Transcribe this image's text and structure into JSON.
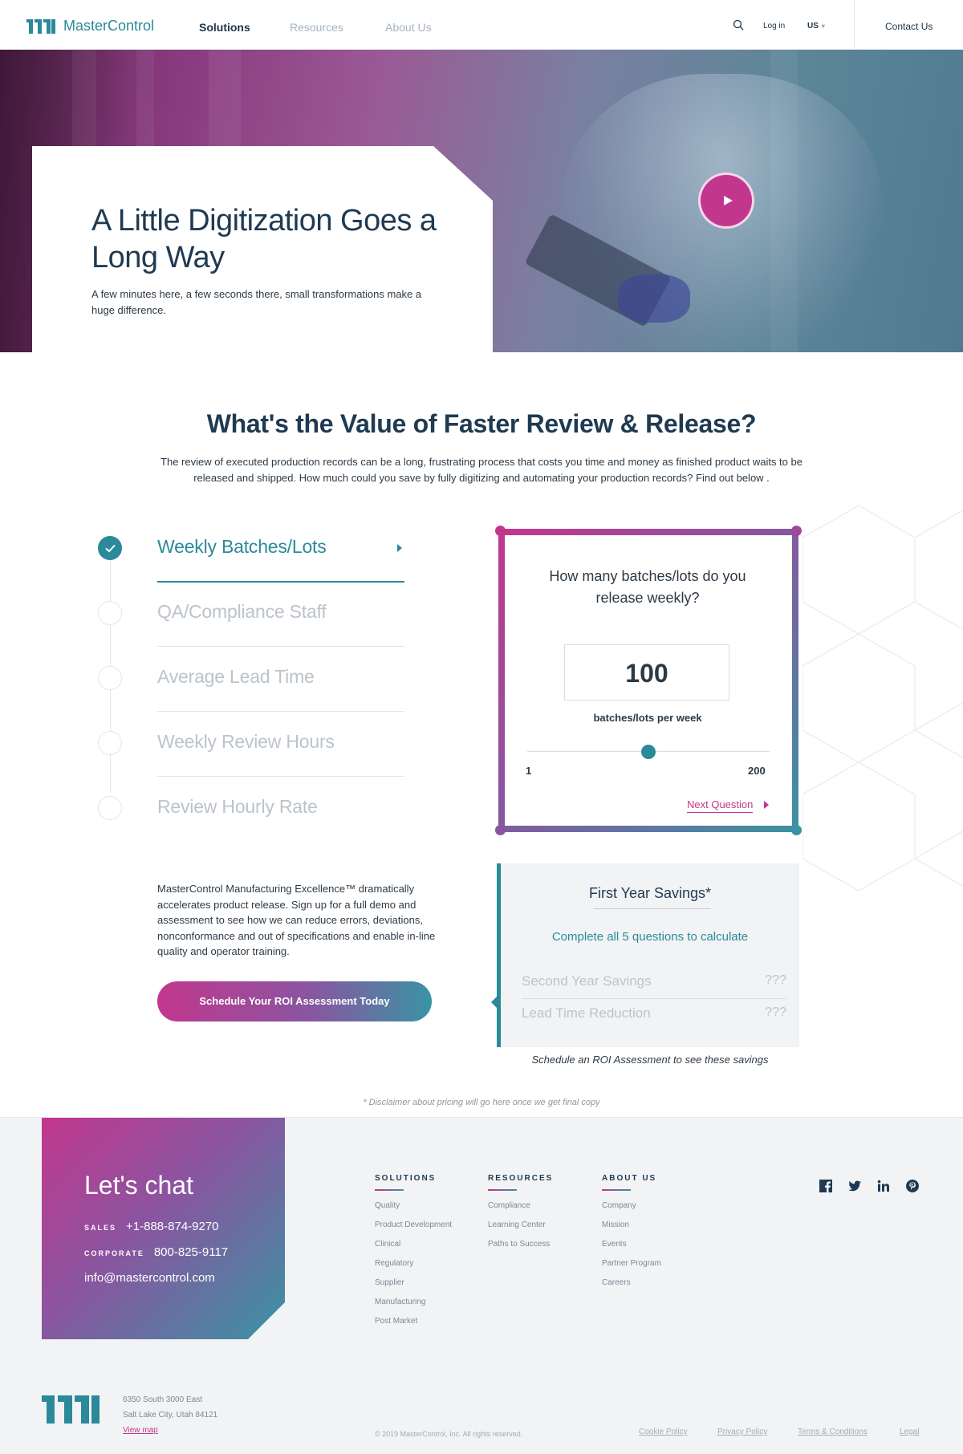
{
  "header": {
    "brand": "MasterControl",
    "nav": [
      "Solutions",
      "Resources",
      "About Us"
    ],
    "login": "Log in",
    "locale": "US",
    "contact": "Contact Us",
    "brand_color": "#2a8a99"
  },
  "hero": {
    "title": "A Little Digitization Goes a Long Way",
    "subtitle": "A few minutes here, a few seconds there, small transformations make a huge difference.",
    "play_icon": "play-icon",
    "accent": "#c2378d"
  },
  "value": {
    "title": "What's the Value of Faster Review & Release?",
    "subtitle": "The review of executed production records can be a long, frustrating process that costs you time and money as finished product waits to be released and shipped. How much could you save by fully  digitizing and automating your production records? Find out below ."
  },
  "steps": [
    {
      "label": "Weekly Batches/Lots",
      "active": true
    },
    {
      "label": "QA/Compliance Staff",
      "active": false
    },
    {
      "label": "Average Lead Time",
      "active": false
    },
    {
      "label": "Weekly Review Hours",
      "active": false
    },
    {
      "label": "Review Hourly Rate",
      "active": false
    }
  ],
  "calculator": {
    "question": "How many batches/lots do you release weekly?",
    "value": "100",
    "unit": "batches/lots per week",
    "slider_min": "1",
    "slider_max": "200",
    "slider_fraction": 0.5,
    "next": "Next Question"
  },
  "promo": {
    "text": "MasterControl Manufacturing Excellence™ dramatically accelerates product release. Sign up for a full demo and assessment to see how we can reduce errors, deviations, nonconformance and out of specifications and enable in-line quality and operator training.",
    "cta": "Schedule Your ROI Assessment Today"
  },
  "savings": {
    "title": "First Year Savings*",
    "complete": "Complete all 5 questions to calculate",
    "rows": [
      {
        "label": "Second Year Savings",
        "value": "???"
      },
      {
        "label": "Lead Time Reduction",
        "value": "???"
      }
    ],
    "note": "Schedule an ROI Assessment to see these savings"
  },
  "disclaimer": "* Disclaimer about pricing will go here once we get final copy",
  "footer": {
    "chat_title": "Let's chat",
    "sales_label": "SALES",
    "sales_phone": "+1-888-874-9270",
    "corporate_label": "CORPORATE",
    "corporate_phone": "800-825-9117",
    "email": "info@mastercontrol.com",
    "columns": [
      {
        "heading": "SOLUTIONS",
        "items": [
          "Quality",
          "Product Development",
          "Clinical",
          "Regulatory",
          "Supplier",
          "Manufacturing",
          "Post Market"
        ]
      },
      {
        "heading": "RESOURCES",
        "items": [
          "Compliance",
          "Learning Center",
          "Paths to Success"
        ]
      },
      {
        "heading": "ABOUT US",
        "items": [
          "Company",
          "Mission",
          "Events",
          "Partner Program",
          "Careers"
        ]
      }
    ],
    "social": [
      "facebook-icon",
      "twitter-icon",
      "linkedin-icon",
      "pinterest-icon"
    ],
    "address_line1": "6350 South 3000 East",
    "address_line2": "Salt Lake City, Utah 84121",
    "view_map": "View map",
    "copyright": "© 2019 MasterControl, Inc. All rights reserved.",
    "legal_links": [
      "Cookie Policy",
      "Privacy Policy",
      "Terms & Conditions",
      "Legal"
    ]
  }
}
